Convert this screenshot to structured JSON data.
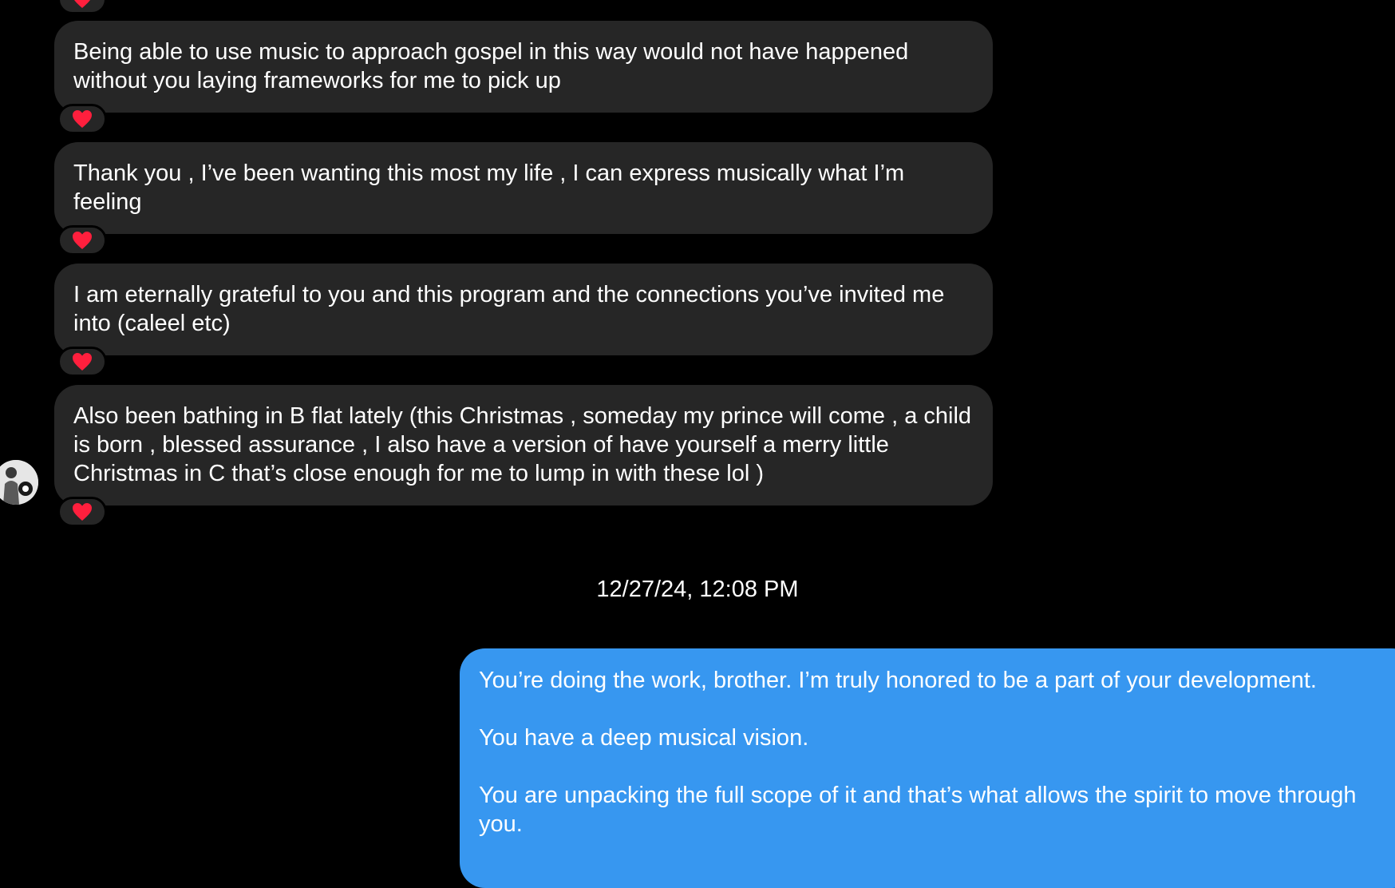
{
  "messages_in": [
    {
      "text": "Being able to use music to approach gospel in this way would not have happened without you laying frameworks for me to pick up",
      "reaction": "heart"
    },
    {
      "text": "Thank you , I’ve been wanting this most my life , I can express musically what I’m feeling",
      "reaction": "heart"
    },
    {
      "text": "I am eternally grateful to you and this program and the connections you’ve invited me into (caleel etc)",
      "reaction": "heart"
    },
    {
      "text": "Also been bathing in B flat lately (this Christmas , someday my prince will come , a child is born , blessed assurance , I also have a version of have yourself a merry little Christmas in C that’s close enough for me to lump in with these lol )",
      "reaction": "heart"
    }
  ],
  "timestamp": "12/27/24, 12:08 PM",
  "message_out": {
    "paragraphs": [
      "You’re doing the work, brother. I’m truly honored to be a part of your development.",
      "You have a deep musical vision.",
      "You are unpacking the full scope of it and that’s what allows the spirit to move through you."
    ]
  },
  "colors": {
    "background": "#000000",
    "incoming_bubble": "#262626",
    "outgoing_bubble": "#3797f0",
    "heart": "#ff1f3d",
    "text": "#ffffff"
  },
  "icons": {
    "reaction": "heart-icon",
    "sender_avatar": "avatar"
  }
}
